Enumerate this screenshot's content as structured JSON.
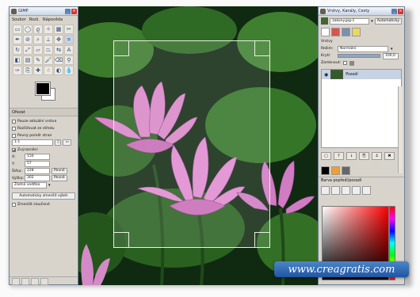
{
  "toolbox": {
    "title": "GIMP",
    "menu": [
      "Soubor",
      "Rozš.",
      "Nápověda"
    ],
    "options_title": "Ořezat",
    "checkboxes": [
      {
        "label": "Pouze aktuální vrstva",
        "checked": false
      },
      {
        "label": "Rozšiřovat ze středu",
        "checked": false
      },
      {
        "label": "Pevný poměr stran",
        "checked": false
      }
    ],
    "ratio_value": "1:1",
    "highlight_label": "Zvýraznění",
    "x_label": "X:",
    "x_value": "150",
    "y_label": "Y:",
    "y_value": "57",
    "width_label": "Šířka:",
    "width_value": "228",
    "height_label": "Výška:",
    "height_value": "302",
    "fixed_label": "Pevné",
    "guides_value": "Žádná vodítka",
    "auto_shrink_label": "Automaticky zmenšit výběr",
    "merged_label": "Zmenšit sloučené"
  },
  "layers": {
    "title": "Vrstvy, Kanály, Cesty",
    "image_name": "zakony.jpg-1",
    "auto_label": "Automaticky",
    "section": "Vrstvy",
    "mode_label": "Režim:",
    "mode_value": "Normální",
    "opacity_label": "Krytí:",
    "opacity_value": "100,0",
    "lock_label": "Zamknout:",
    "layer_name": "Pozadí",
    "palette_label": "Barva popředí/pozadí"
  },
  "watermark": "www.creagratis.com",
  "colors": {
    "title_red": "#d8342c",
    "accent": "#2055a3"
  }
}
